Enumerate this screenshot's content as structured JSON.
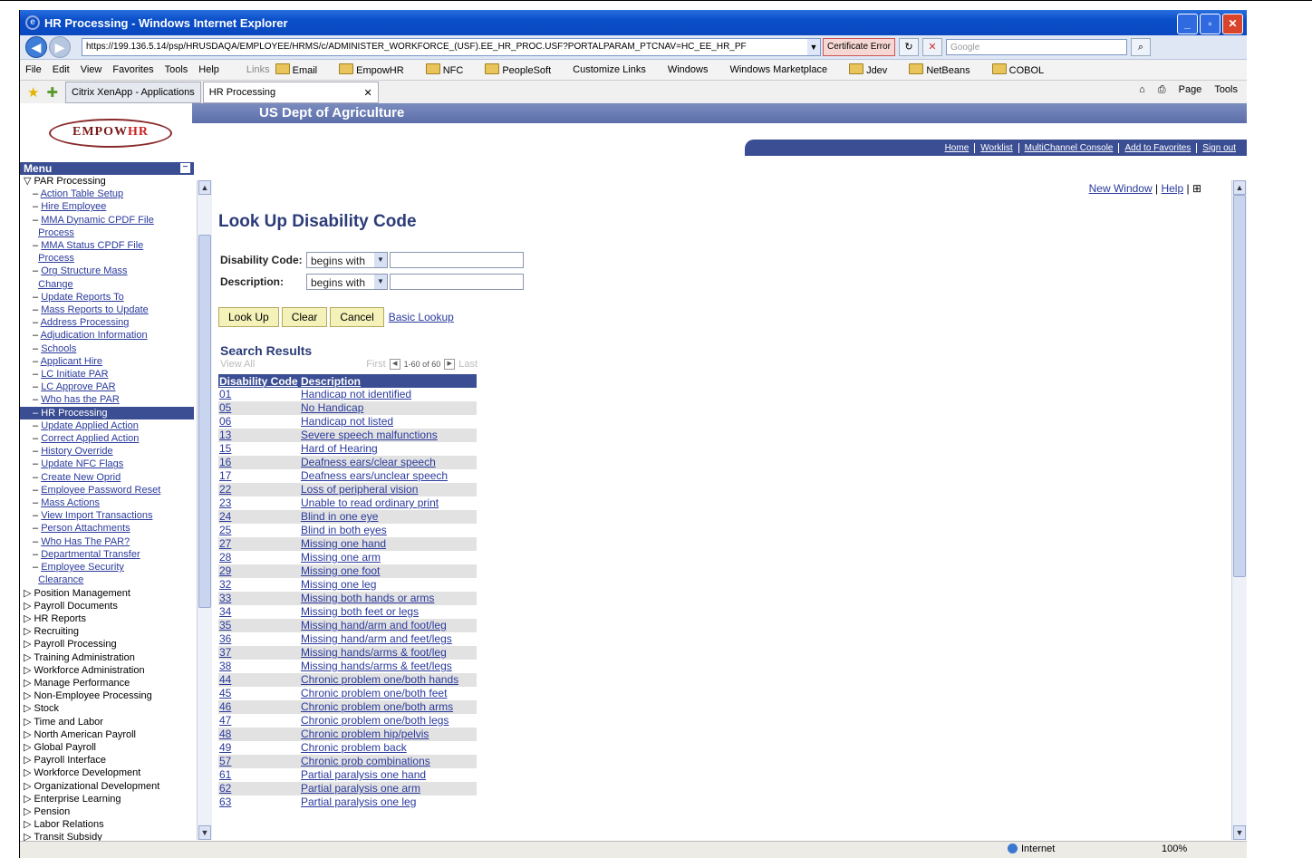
{
  "window": {
    "title": "HR Processing - Windows Internet Explorer",
    "min": "_",
    "max": "▫",
    "close": "✕"
  },
  "address": {
    "url": "https://199.136.5.14/psp/HRUSDAQA/EMPLOYEE/HRMS/c/ADMINISTER_WORKFORCE_(USF).EE_HR_PROC.USF?PORTALPARAM_PTCNAV=HC_EE_HR_PF",
    "cert_label": "Certificate Error",
    "search_placeholder": "Google"
  },
  "menubar": {
    "items": [
      "File",
      "Edit",
      "View",
      "Favorites",
      "Tools",
      "Help"
    ],
    "links_label": "Links",
    "links": [
      "Email",
      "EmpowHR",
      "NFC",
      "PeopleSoft",
      "Customize Links",
      "Windows",
      "Windows Marketplace",
      "Jdev",
      "NetBeans",
      "COBOL"
    ]
  },
  "tabs": {
    "citrix": "Citrix XenApp - Applications",
    "active": "HR Processing",
    "page_label": "Page",
    "tools_label": "Tools"
  },
  "header": {
    "logo_a": "EMPOW",
    "logo_b": "HR",
    "agency": "US Dept of Agriculture",
    "links": [
      "Home",
      "Worklist",
      "MultiChannel Console",
      "Add to Favorites",
      "Sign out"
    ]
  },
  "menu": {
    "title": "Menu",
    "root": "PAR Processing",
    "items": [
      [
        "Action Table Setup"
      ],
      [
        "Hire Employee"
      ],
      [
        "MMA Dynamic CPDF File",
        "Process"
      ],
      [
        "MMA Status CPDF File",
        "Process"
      ],
      [
        "Org Structure Mass",
        "Change"
      ],
      [
        "Update Reports To"
      ],
      [
        "Mass Reports to Update"
      ],
      [
        "Address Processing"
      ],
      [
        "Adjudication Information"
      ],
      [
        "Schools"
      ],
      [
        "Applicant Hire"
      ],
      [
        "LC Initiate PAR"
      ],
      [
        "LC Approve PAR"
      ],
      [
        "Who has the PAR"
      ]
    ],
    "current": "HR Processing",
    "items2": [
      [
        "Update Applied Action"
      ],
      [
        "Correct Applied Action"
      ],
      [
        "History Override"
      ],
      [
        "Update NFC Flags"
      ],
      [
        "Create New Oprid"
      ],
      [
        "Employee Password Reset"
      ],
      [
        "Mass Actions"
      ],
      [
        "View Import Transactions"
      ],
      [
        "Person Attachments"
      ],
      [
        "Who Has The PAR?"
      ],
      [
        "Departmental Transfer"
      ],
      [
        "Employee Security",
        "Clearance"
      ]
    ],
    "groups": [
      "Position Management",
      "Payroll Documents",
      "HR Reports",
      "Recruiting",
      "Payroll Processing",
      "Training Administration",
      "Workforce Administration",
      "Manage Performance",
      "Non-Employee Processing",
      "Stock",
      "Time and Labor",
      "North American Payroll",
      "Global Payroll",
      "Payroll Interface",
      "Workforce Development",
      "Organizational Development",
      "Enterprise Learning",
      "Pension",
      "Labor Relations",
      "Transit Subsidy"
    ]
  },
  "main": {
    "new_window": "New Window",
    "help": "Help",
    "title": "Look Up Disability Code",
    "field1_label": "Disability Code:",
    "field2_label": "Description:",
    "operator": "begins with",
    "btn_lookup": "Look Up",
    "btn_clear": "Clear",
    "btn_cancel": "Cancel",
    "basic_lookup": "Basic Lookup",
    "results_title": "Search Results",
    "view_all": "View All",
    "first": "First",
    "count": "1-60 of 60",
    "last": "Last",
    "col_code": "Disability Code",
    "col_desc": "Description",
    "rows": [
      [
        "01",
        "Handicap not identified"
      ],
      [
        "05",
        "No Handicap"
      ],
      [
        "06",
        "Handicap not listed"
      ],
      [
        "13",
        "Severe speech malfunctions"
      ],
      [
        "15",
        "Hard of Hearing"
      ],
      [
        "16",
        "Deafness ears/clear speech"
      ],
      [
        "17",
        "Deafness ears/unclear speech"
      ],
      [
        "22",
        "Loss of peripheral vision"
      ],
      [
        "23",
        "Unable to read ordinary print"
      ],
      [
        "24",
        "Blind in one eye"
      ],
      [
        "25",
        "Blind in both eyes"
      ],
      [
        "27",
        "Missing one hand"
      ],
      [
        "28",
        "Missing one arm"
      ],
      [
        "29",
        "Missing one foot"
      ],
      [
        "32",
        "Missing one leg"
      ],
      [
        "33",
        "Missing both hands or arms"
      ],
      [
        "34",
        "Missing both feet or legs"
      ],
      [
        "35",
        "Missing hand/arm and foot/leg"
      ],
      [
        "36",
        "Missing hand/arm and feet/legs"
      ],
      [
        "37",
        "Missing hands/arms & foot/leg"
      ],
      [
        "38",
        "Missing hands/arms & feet/legs"
      ],
      [
        "44",
        "Chronic problem one/both hands"
      ],
      [
        "45",
        "Chronic problem one/both feet"
      ],
      [
        "46",
        "Chronic problem one/both arms"
      ],
      [
        "47",
        "Chronic problem one/both legs"
      ],
      [
        "48",
        "Chronic problem hip/pelvis"
      ],
      [
        "49",
        "Chronic problem back"
      ],
      [
        "57",
        "Chronic prob combinations"
      ],
      [
        "61",
        "Partial paralysis one hand"
      ],
      [
        "62",
        "Partial paralysis one arm"
      ],
      [
        "63",
        "Partial paralysis one leg"
      ]
    ]
  },
  "status": {
    "zone": "Internet",
    "zoom": "100%"
  }
}
